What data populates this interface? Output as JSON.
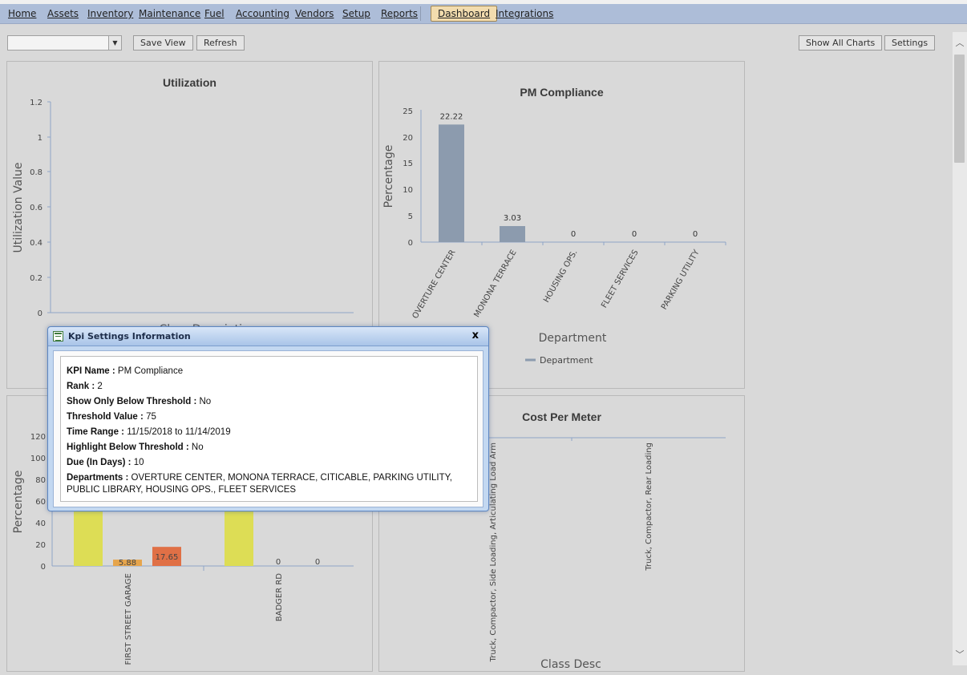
{
  "menu": {
    "items": [
      "Home",
      "Assets",
      "Inventory",
      "Maintenance",
      "Fuel",
      "Accounting",
      "Vendors",
      "Setup",
      "Reports"
    ],
    "active": "Dashboard",
    "integrations": "Integrations"
  },
  "toolbar": {
    "view_select_value": "",
    "save_view": "Save View",
    "refresh": "Refresh",
    "show_all_charts": "Show All Charts",
    "settings": "Settings"
  },
  "charts": {
    "utilization": {
      "title": "Utilization",
      "ylabel": "Utilization Value",
      "xlabel_partial": "Class Description",
      "yticks": [
        "0",
        "0.2",
        "0.4",
        "0.6",
        "0.8",
        "1",
        "1.2"
      ]
    },
    "pm": {
      "title": "PM Compliance",
      "ylabel": "Percentage",
      "xlabel": "Department",
      "legend": "Department",
      "yticks": [
        "0",
        "5",
        "10",
        "15",
        "20",
        "25"
      ]
    },
    "bottom_left": {
      "ylabel": "Percentage",
      "yticks": [
        "0",
        "20",
        "40",
        "60",
        "80",
        "100",
        "120"
      ]
    },
    "cost": {
      "title": "Cost Per Meter",
      "xlabel": "Class Desc",
      "categories": [
        "Truck, Compactor, Side Loading, Articulating Load Arm",
        "Truck, Compactor, Rear Loading"
      ]
    }
  },
  "chart_data": [
    {
      "type": "bar",
      "title": "Utilization",
      "ylabel": "Utilization Value",
      "ylim": [
        0,
        1.2
      ],
      "categories": [],
      "values": []
    },
    {
      "type": "bar",
      "title": "PM Compliance",
      "xlabel": "Department",
      "ylabel": "Percentage",
      "ylim": [
        0,
        25
      ],
      "categories": [
        "OVERTURE CENTER",
        "MONONA TERRACE",
        "HOUSING OPS.",
        "FLEET SERVICES",
        "PARKING UTILITY"
      ],
      "values": [
        22.22,
        3.03,
        0,
        0,
        0
      ],
      "series_color": "#8c9bae",
      "legend": "Department"
    },
    {
      "type": "bar",
      "ylabel": "Percentage",
      "ylim": [
        0,
        120
      ],
      "categories": [
        "FIRST STREET GARAGE",
        "BADGER RD"
      ],
      "series": [
        {
          "values": [
            76.47,
            100
          ],
          "color": "#dddd55"
        },
        {
          "values": [
            5.88,
            0
          ],
          "color": "#e6a54c"
        },
        {
          "values": [
            17.65,
            0
          ],
          "color": "#e07046"
        }
      ],
      "value_labels": [
        "76.47",
        "5.88",
        "17.65",
        "100",
        "0",
        "0"
      ]
    },
    {
      "type": "bar",
      "title": "Cost Per Meter",
      "xlabel": "Class Desc",
      "categories": [
        "Truck, Compactor, Side Loading, Articulating Load Arm",
        "Truck, Compactor, Rear Loading"
      ],
      "values": []
    }
  ],
  "modal": {
    "title": "Kpi Settings Information",
    "close": "x",
    "fields": [
      {
        "label": "KPI Name :",
        "value": "PM Compliance"
      },
      {
        "label": "Rank :",
        "value": "2"
      },
      {
        "label": "Show Only Below Threshold :",
        "value": "No"
      },
      {
        "label": "Threshold Value :",
        "value": "75"
      },
      {
        "label": "Time Range :",
        "value": "11/15/2018 to 11/14/2019"
      },
      {
        "label": "Highlight Below Threshold :",
        "value": "No"
      },
      {
        "label": "Due (In Days) :",
        "value": "10"
      },
      {
        "label": "Departments :",
        "value": "OVERTURE CENTER, MONONA TERRACE, CITICABLE, PARKING UTILITY, PUBLIC LIBRARY, HOUSING OPS., FLEET SERVICES"
      }
    ]
  }
}
